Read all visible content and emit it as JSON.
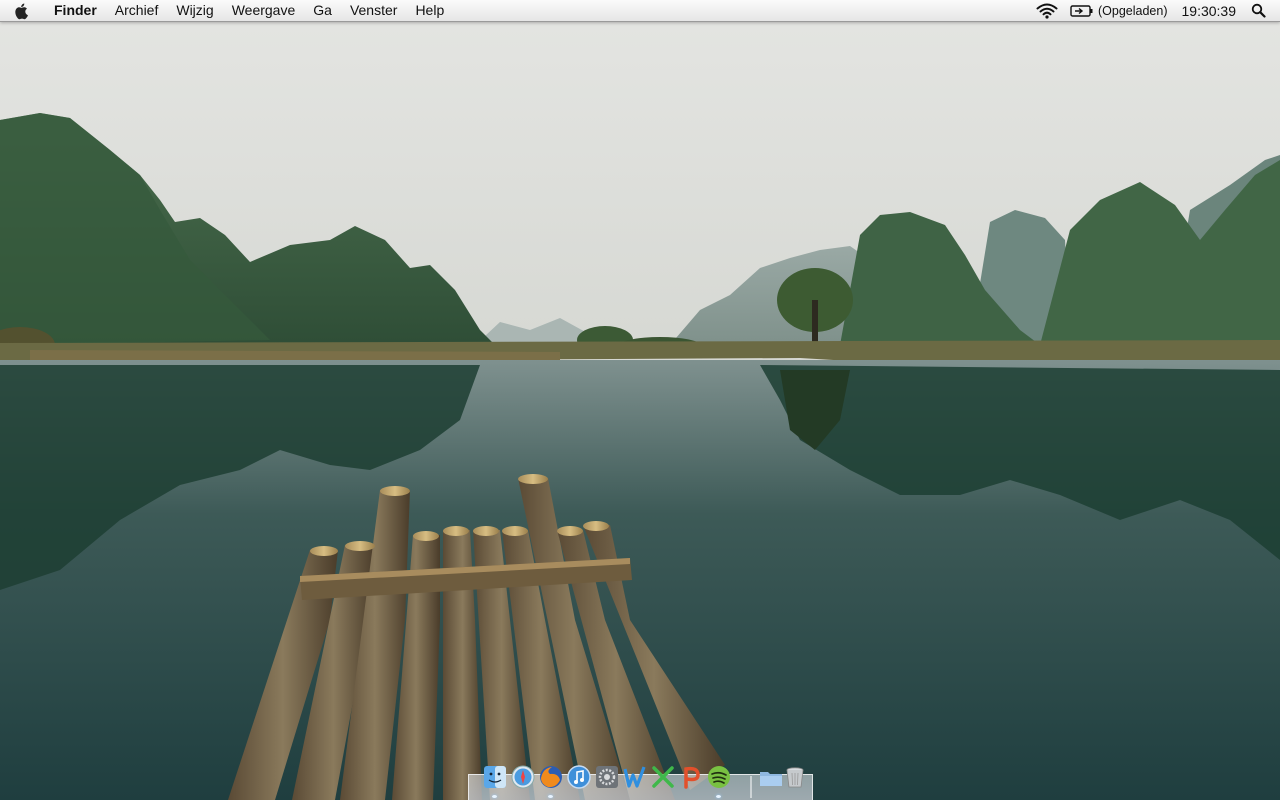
{
  "menubar": {
    "app_name": "Finder",
    "items": [
      "Archief",
      "Wijzig",
      "Weergave",
      "Ga",
      "Venster",
      "Help"
    ],
    "battery_status": "(Opgeladen)",
    "clock": "19:30:39"
  },
  "icons": {
    "apple": "apple-logo-icon",
    "wifi": "wifi-icon",
    "battery": "battery-charging-icon",
    "spotlight": "spotlight-search-icon"
  },
  "dock": {
    "apps": [
      "Finder",
      "Safari",
      "Firefox",
      "iTunes",
      "Systeemvoorkeuren",
      "Word",
      "Excel",
      "PowerPoint",
      "Spotify"
    ],
    "stacks": [
      "Programma's",
      "Prullenmand"
    ]
  }
}
